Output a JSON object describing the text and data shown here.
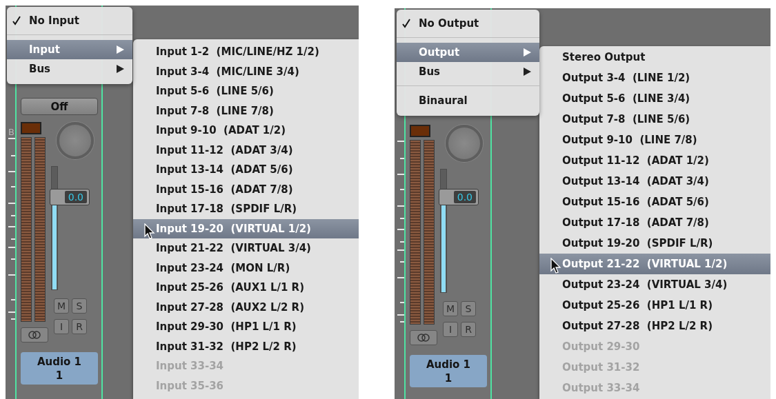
{
  "panels": [
    {
      "strip": {
        "scale_label": "B",
        "off_button": "Off",
        "fader_value": "0.0",
        "level": 0.75,
        "buttons": [
          "M",
          "S",
          "I",
          "R"
        ],
        "name": "Audio 1",
        "number": "1"
      },
      "menu": {
        "items": [
          {
            "kind": "check",
            "label": "No Input",
            "checked": true
          },
          {
            "kind": "separator"
          },
          {
            "kind": "submenu",
            "label": "Input",
            "selected": true
          },
          {
            "kind": "submenu",
            "label": "Bus",
            "selected": false
          }
        ]
      },
      "submenu": {
        "items": [
          {
            "label": "Input 1-2  (MIC/LINE/HZ 1/2)",
            "selected": false,
            "disabled": false
          },
          {
            "label": "Input 3-4  (MIC/LINE 3/4)",
            "selected": false,
            "disabled": false
          },
          {
            "label": "Input 5-6  (LINE 5/6)",
            "selected": false,
            "disabled": false
          },
          {
            "label": "Input 7-8  (LINE 7/8)",
            "selected": false,
            "disabled": false
          },
          {
            "label": "Input 9-10  (ADAT 1/2)",
            "selected": false,
            "disabled": false
          },
          {
            "label": "Input 11-12  (ADAT 3/4)",
            "selected": false,
            "disabled": false
          },
          {
            "label": "Input 13-14  (ADAT 5/6)",
            "selected": false,
            "disabled": false
          },
          {
            "label": "Input 15-16  (ADAT 7/8)",
            "selected": false,
            "disabled": false
          },
          {
            "label": "Input 17-18  (SPDIF L/R)",
            "selected": false,
            "disabled": false
          },
          {
            "label": "Input 19-20  (VIRTUAL 1/2)",
            "selected": true,
            "disabled": false
          },
          {
            "label": "Input 21-22  (VIRTUAL 3/4)",
            "selected": false,
            "disabled": false
          },
          {
            "label": "Input 23-24  (MON L/R)",
            "selected": false,
            "disabled": false
          },
          {
            "label": "Input 25-26  (AUX1 L/1 R)",
            "selected": false,
            "disabled": false
          },
          {
            "label": "Input 27-28  (AUX2 L/2 R)",
            "selected": false,
            "disabled": false
          },
          {
            "label": "Input 29-30  (HP1 L/1 R)",
            "selected": false,
            "disabled": false
          },
          {
            "label": "Input 31-32  (HP2 L/2 R)",
            "selected": false,
            "disabled": false
          },
          {
            "label": "Input 33-34",
            "selected": false,
            "disabled": true
          },
          {
            "label": "Input 35-36",
            "selected": false,
            "disabled": true
          }
        ]
      }
    },
    {
      "strip": {
        "fader_value": "0.0",
        "level": 0.77,
        "buttons": [
          "M",
          "S",
          "I",
          "R"
        ],
        "name": "Audio 1",
        "number": "1"
      },
      "menu": {
        "items": [
          {
            "kind": "check",
            "label": "No Output",
            "checked": true
          },
          {
            "kind": "separator"
          },
          {
            "kind": "submenu",
            "label": "Output",
            "selected": true
          },
          {
            "kind": "submenu",
            "label": "Bus",
            "selected": false
          },
          {
            "kind": "separator"
          },
          {
            "kind": "plain",
            "label": "Binaural"
          }
        ]
      },
      "submenu": {
        "items": [
          {
            "label": "Stereo Output",
            "selected": false,
            "disabled": false
          },
          {
            "label": "Output 3-4  (LINE 1/2)",
            "selected": false,
            "disabled": false
          },
          {
            "label": "Output 5-6  (LINE 3/4)",
            "selected": false,
            "disabled": false
          },
          {
            "label": "Output 7-8  (LINE 5/6)",
            "selected": false,
            "disabled": false
          },
          {
            "label": "Output 9-10  (LINE 7/8)",
            "selected": false,
            "disabled": false
          },
          {
            "label": "Output 11-12  (ADAT 1/2)",
            "selected": false,
            "disabled": false
          },
          {
            "label": "Output 13-14  (ADAT 3/4)",
            "selected": false,
            "disabled": false
          },
          {
            "label": "Output 15-16  (ADAT 5/6)",
            "selected": false,
            "disabled": false
          },
          {
            "label": "Output 17-18  (ADAT 7/8)",
            "selected": false,
            "disabled": false
          },
          {
            "label": "Output 19-20  (SPDIF L/R)",
            "selected": false,
            "disabled": false
          },
          {
            "label": "Output 21-22  (VIRTUAL 1/2)",
            "selected": true,
            "disabled": false
          },
          {
            "label": "Output 23-24  (VIRTUAL 3/4)",
            "selected": false,
            "disabled": false
          },
          {
            "label": "Output 25-26  (HP1 L/1 R)",
            "selected": false,
            "disabled": false
          },
          {
            "label": "Output 27-28  (HP2 L/2 R)",
            "selected": false,
            "disabled": false
          },
          {
            "label": "Output 29-30",
            "selected": false,
            "disabled": true
          },
          {
            "label": "Output 31-32",
            "selected": false,
            "disabled": true
          },
          {
            "label": "Output 33-34",
            "selected": false,
            "disabled": true
          }
        ]
      }
    }
  ]
}
